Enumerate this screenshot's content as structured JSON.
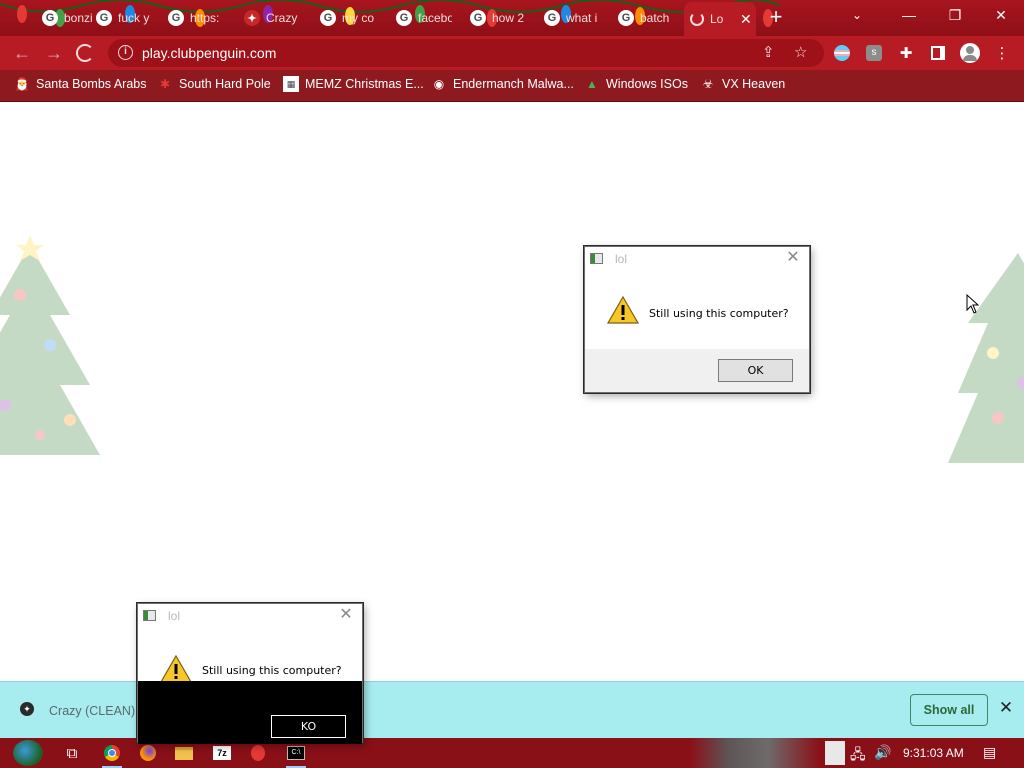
{
  "tabs": [
    {
      "title": "bonzi",
      "icon": "google-icon"
    },
    {
      "title": "fuck y",
      "icon": "google-icon"
    },
    {
      "title": "https:",
      "icon": "google-icon"
    },
    {
      "title": "Crazy",
      "icon": "crazy-icon"
    },
    {
      "title": "my co",
      "icon": "google-icon"
    },
    {
      "title": "facebo",
      "icon": "google-icon"
    },
    {
      "title": "how 2",
      "icon": "google-icon"
    },
    {
      "title": "what i",
      "icon": "google-icon"
    },
    {
      "title": "batch",
      "icon": "google-icon"
    },
    {
      "title": "Lo",
      "icon": "loading-icon",
      "active": true
    }
  ],
  "address_bar": {
    "url": "play.clubpenguin.com"
  },
  "bookmarks": [
    {
      "label": "Santa Bombs Arabs",
      "icon": "santa-icon"
    },
    {
      "label": "South Hard Pole",
      "icon": "snowflake-icon"
    },
    {
      "label": "MEMZ Christmas E...",
      "icon": "memz-icon"
    },
    {
      "label": "Endermanch Malwa...",
      "icon": "enderman-icon"
    },
    {
      "label": "Windows ISOs",
      "icon": "tree-icon"
    },
    {
      "label": "VX Heaven",
      "icon": "vx-icon"
    }
  ],
  "dialogs": [
    {
      "caption": "lol",
      "message": "Still using this computer?",
      "button": "OK"
    },
    {
      "caption": "lol",
      "message": "Still using this computer?",
      "button": "KO"
    }
  ],
  "download_shelf": {
    "file_name": "Crazy (CLEAN).l",
    "show_all_label": "Show all"
  },
  "taskbar": {
    "apps": [
      "task-view-icon",
      "chrome-icon",
      "firefox-icon",
      "file-explorer-icon",
      "7zip-icon",
      "malware-app-icon",
      "cmd-icon"
    ],
    "clock": "9:31:03 AM"
  },
  "colors": {
    "chrome_frame": "#a8151e",
    "toolbar": "#b71c24",
    "bookmarks_bar": "#8e1a20",
    "download_shelf": "#a7ecee",
    "taskbar": "#8a1018"
  }
}
